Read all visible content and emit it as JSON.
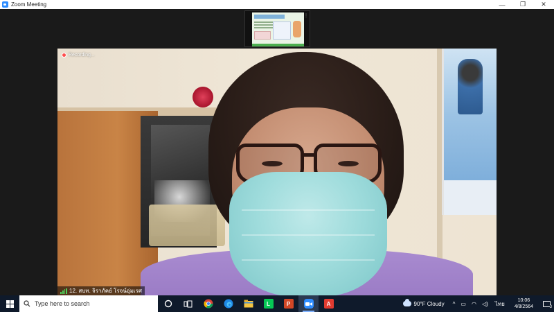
{
  "window": {
    "title": "Zoom Meeting",
    "minimize_glyph": "—",
    "maximize_glyph": "❐",
    "close_glyph": "✕"
  },
  "meeting": {
    "recording_label": "Recording...",
    "participant_name": "12. สบท. จิราภัคย์ โรจน์อุ่มเรศ"
  },
  "taskbar": {
    "search_placeholder": "Type here to search",
    "apps": [
      "cortana-icon",
      "task-view-icon",
      "chrome-icon",
      "edge-icon",
      "file-explorer-icon",
      "line-icon",
      "powerpoint-icon",
      "zoom-icon",
      "acrobat-icon"
    ],
    "weather": "90°F  Cloudy",
    "language": "ไทย",
    "time": "10:06",
    "date": "4/8/2564",
    "notification_count": "3"
  },
  "colors": {
    "zoom_blue": "#2d8cff",
    "taskbar_bg": "#0f1a2b",
    "recording_red": "#ff4d4d"
  }
}
